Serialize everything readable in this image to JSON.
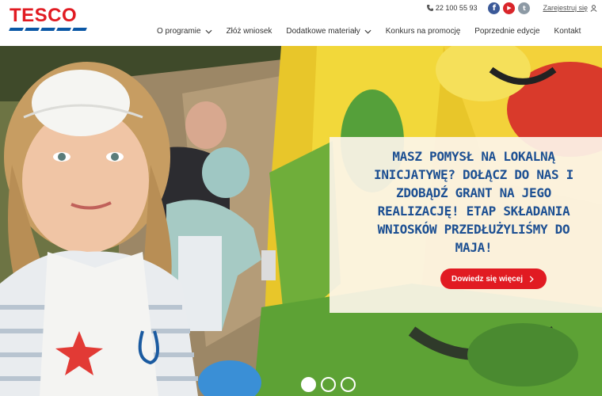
{
  "brand": {
    "logo_text": "TESCO",
    "red": "#e11b22",
    "blue": "#0a57a5"
  },
  "topbar": {
    "phone": "22 100 55 93",
    "social": [
      {
        "icon": "facebook-icon",
        "glyph": "f"
      },
      {
        "icon": "youtube-icon",
        "glyph": "▶"
      },
      {
        "icon": "twitter-icon",
        "glyph": "t"
      }
    ],
    "register_label": "Zarejestruj się"
  },
  "nav": [
    {
      "label": "O programie",
      "dropdown": true
    },
    {
      "label": "Złóż wniosek",
      "dropdown": false
    },
    {
      "label": "Dodatkowe materiały",
      "dropdown": true
    },
    {
      "label": "Konkurs na promocję",
      "dropdown": false
    },
    {
      "label": "Poprzednie edycje",
      "dropdown": false
    },
    {
      "label": "Kontakt",
      "dropdown": false
    }
  ],
  "hero": {
    "headline_lines": [
      "MASZ POMYSŁ NA LOKALNĄ",
      "INICJATYWĘ? DOŁĄCZ DO NAS I",
      "ZDOBĄDŹ GRANT NA JEGO",
      "REALIZACJĘ! ETAP SKŁADANIA",
      "WNIOSKÓW PRZEDŁUŻYLIŚMY DO",
      "MAJA!"
    ],
    "button_label": "Dowiedz się więcej",
    "accent": "#1c4f92"
  },
  "carousel": {
    "slides": 3,
    "active_index": 0
  }
}
